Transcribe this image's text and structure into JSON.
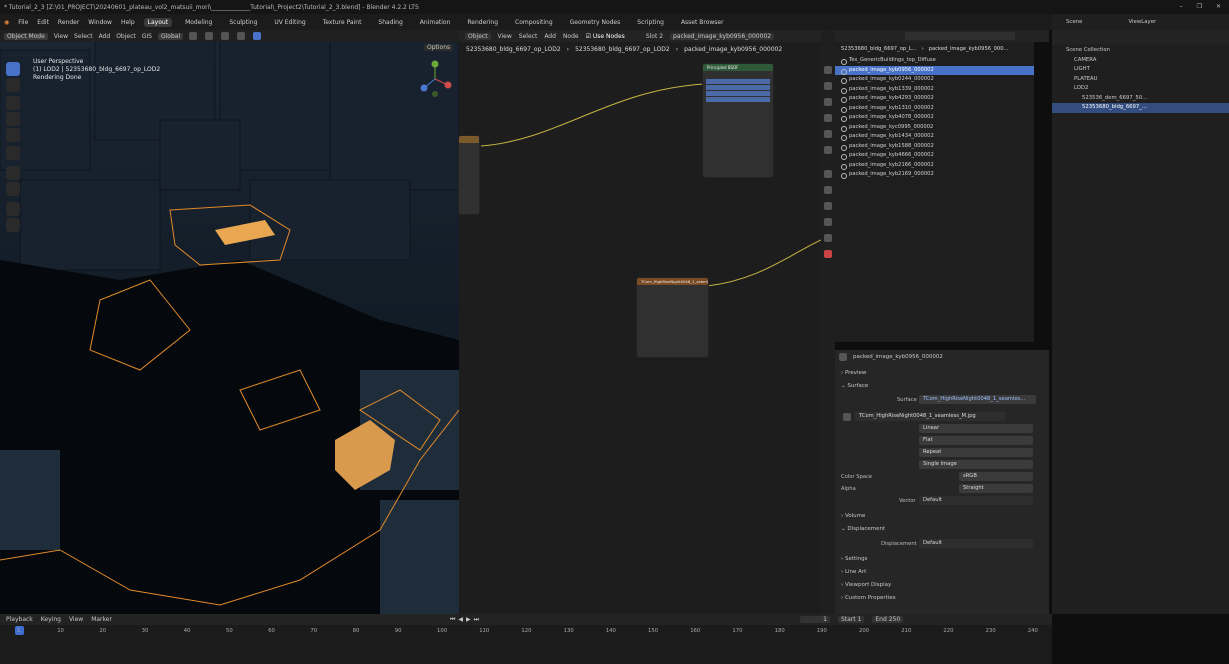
{
  "title_bar": {
    "text": "* Tutorial_2_3 [Z:\\01_PROJECT\\20240601_plateau_vol2_matsuii_mori\\_____________Tutorial\\_Project2\\Tutorial_2_3.blend] - Blender 4.2.2 LTS",
    "controls": [
      "–",
      "❐",
      "✕"
    ]
  },
  "menu": [
    "File",
    "Edit",
    "Render",
    "Window",
    "Help"
  ],
  "workspaces": [
    "Layout",
    "Modeling",
    "Sculpting",
    "UV Editing",
    "Texture Paint",
    "Shading",
    "Animation",
    "Rendering",
    "Compositing",
    "Geometry Nodes",
    "Scripting",
    "Asset Browser"
  ],
  "workspace_active": "Layout",
  "viewport": {
    "mode": "Object Mode",
    "menus": [
      "View",
      "Select",
      "Add",
      "Object"
    ],
    "gis": "GIS",
    "orientation": "Global",
    "options": "Options",
    "info": [
      "User Perspective",
      "(1) LOD2 | 52353680_bldg_6697_op_LOD2",
      "Rendering Done"
    ]
  },
  "node_editor": {
    "type": "Object",
    "menus": [
      "View",
      "Select",
      "Add",
      "Node"
    ],
    "use_nodes": "Use Nodes",
    "slot": "Slot 2",
    "material": "packed_image_kyb0956_000002",
    "breadcrumb": [
      "52353680_bldg_6697_op_LOD2",
      "52353680_bldg_6697_op_LOD2",
      "packed_image_kyb0956_000002"
    ],
    "bsdf_title": "Principled BSDF",
    "image_node_title": "TCom_HighRiseNight0048_1_seamless"
  },
  "image_list": {
    "search": "",
    "header_left": "52353680_bldg_6697_op_L...",
    "header_right": "packed_image_kyb0956_000...",
    "items": [
      "Tex_GenericBuildings_top_Diffuse",
      "packed_image_kyb0956_000002",
      "packed_image_kyb0244_000002",
      "packed_image_kyb1339_000002",
      "packed_image_kyb4293_000002",
      "packed_image_kyb1310_000002",
      "packed_image_kyb4078_000002",
      "packed_image_kyc0995_000002",
      "packed_image_kyb1434_000002",
      "packed_image_kyb1588_000002",
      "packed_image_kyb4666_000002",
      "packed_image_kyb2166_000002",
      "packed_image_kyb2169_000002"
    ],
    "selected_index": 1
  },
  "material_panel": {
    "material": "packed_image_kyb0956_000002",
    "preview": "Preview",
    "surface_section": "Surface",
    "surface_label": "Surface",
    "surface_value": "TCom_HighRiseNight0048_1_seamles...",
    "image_file": "TCom_HighRiseNight0048_1_seamless_M.jpg",
    "interpolation": "Linear",
    "projection": "Flat",
    "extension": "Repeat",
    "source": "Single Image",
    "color_space_label": "Color Space",
    "color_space": "sRGB",
    "alpha_label": "Alpha",
    "alpha": "Straight",
    "vector_label": "Vector",
    "vector": "Default",
    "volume": "Volume",
    "displacement_section": "Displacement",
    "displacement_label": "Displacement",
    "displacement": "Default",
    "settings": "Settings",
    "line_art": "Line Art",
    "viewport_display": "Viewport Display",
    "custom_properties": "Custom Properties"
  },
  "outliner": {
    "scene": "Scene",
    "view_layer": "ViewLayer",
    "collection": "Scene Collection",
    "items": [
      "CAMERA",
      "LIGHT",
      "PLATEAU",
      "LOD2",
      "523536_dem_6697_50...",
      "52353680_bldg_6697_..."
    ]
  },
  "timeline": {
    "menus": [
      "Playback",
      "Keying",
      "View",
      "Marker"
    ],
    "current": "1",
    "start_label": "Start",
    "start": "1",
    "end_label": "End",
    "end": "250",
    "ticks": [
      "1",
      "10",
      "20",
      "30",
      "40",
      "50",
      "60",
      "70",
      "80",
      "90",
      "100",
      "110",
      "120",
      "130",
      "140",
      "150",
      "160",
      "170",
      "180",
      "190",
      "200",
      "210",
      "220",
      "230",
      "240"
    ]
  },
  "colors": {
    "selection": "#4872c7",
    "outline": "#e08a2a",
    "timeline_current": "#3f6fd1"
  }
}
